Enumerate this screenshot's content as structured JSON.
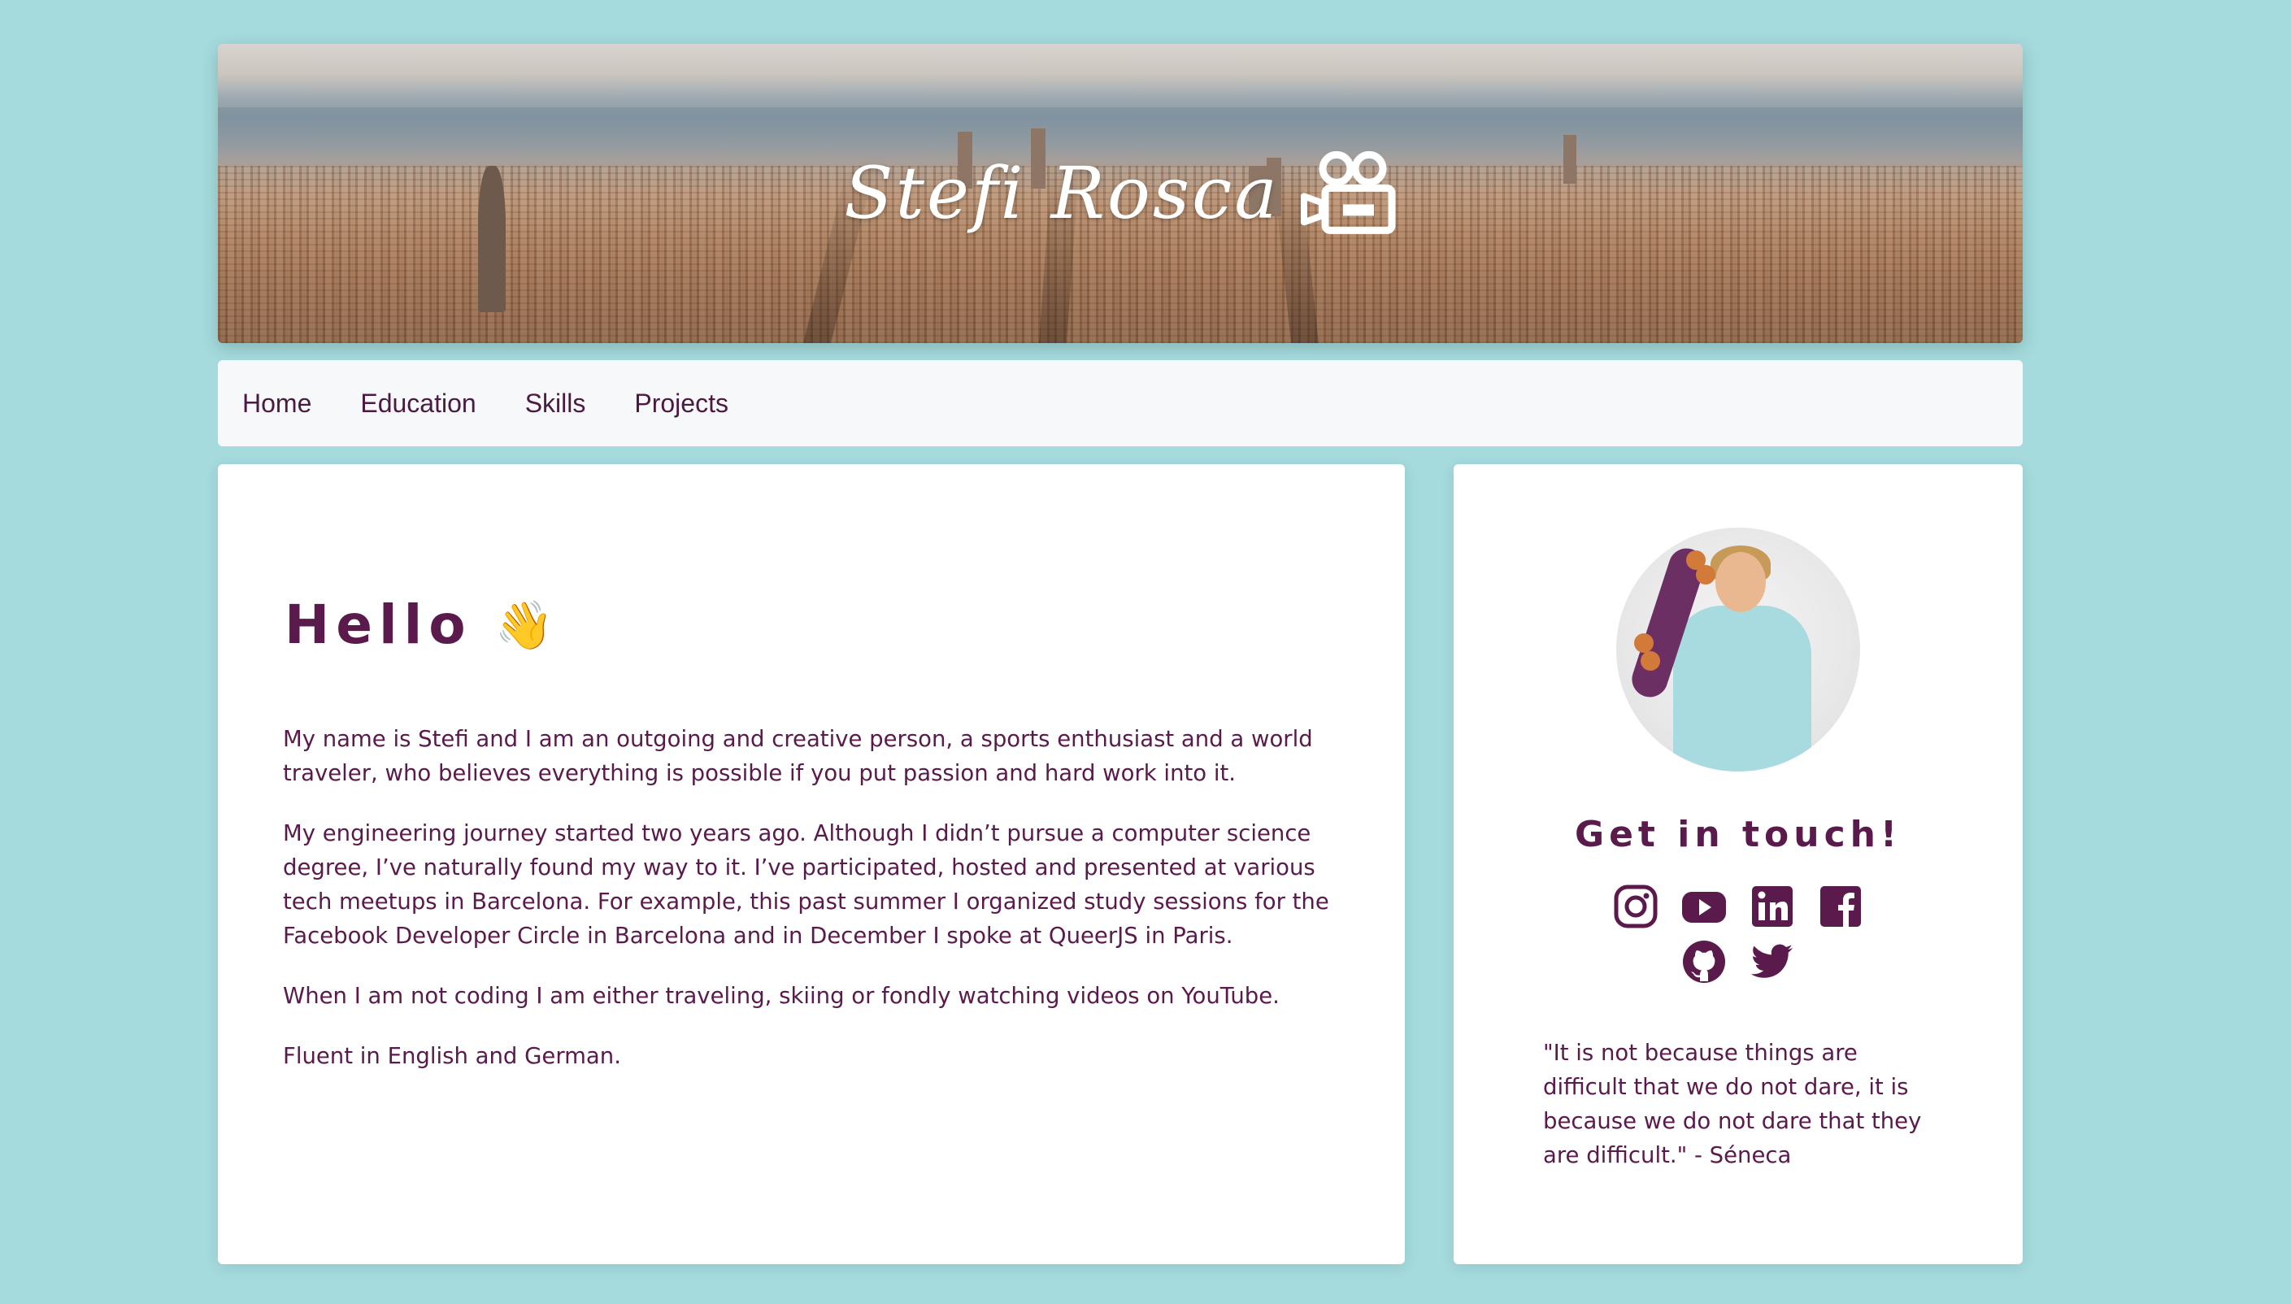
{
  "banner": {
    "title": "Stefi Rosca",
    "logo_icon": "video-camera-icon"
  },
  "nav": {
    "items": [
      "Home",
      "Education",
      "Skills",
      "Projects"
    ]
  },
  "main": {
    "heading": "Hello",
    "heading_emoji": "👋",
    "paragraphs": [
      "My name is Stefi and I am an outgoing and creative person, a sports enthusiast and a world traveler, who believes everything is possible if you put passion and hard work into it.",
      "My engineering journey started two years ago. Although I didn’t pursue a computer science degree, I’ve naturally found my way to it. I’ve participated, hosted and presented at various tech meetups in Barcelona. For example, this past summer I organized study sessions for the Facebook Developer Circle in Barcelona and in December I spoke at QueerJS in Paris.",
      "When I am not coding I am either traveling, skiing or fondly watching videos on YouTube.",
      "Fluent in English and German."
    ]
  },
  "side": {
    "heading": "Get in touch!",
    "socials": [
      {
        "icon": "instagram-icon"
      },
      {
        "icon": "youtube-icon"
      },
      {
        "icon": "linkedin-icon"
      },
      {
        "icon": "facebook-icon"
      },
      {
        "icon": "github-icon"
      },
      {
        "icon": "twitter-icon"
      }
    ],
    "quote": "\"It is not because things are difficult that we do not dare, it is because we do not dare that they are difficult.\" - Séneca"
  },
  "colors": {
    "background": "#a5dbdd",
    "text": "#5a1a4c",
    "nav_background": "#f7f8fa",
    "card": "#ffffff"
  }
}
